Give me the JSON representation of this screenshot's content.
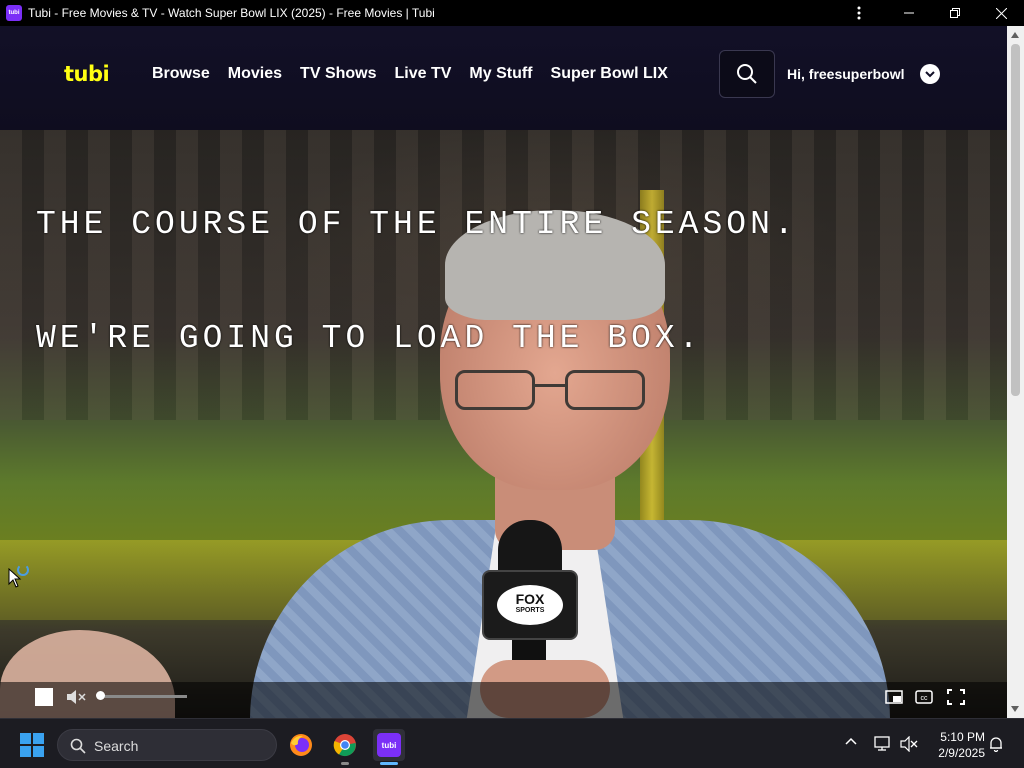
{
  "window": {
    "title": "Tubi - Free Movies & TV - Watch Super Bowl LIX (2025) - Free Movies | Tubi",
    "app_icon_text": "tubi"
  },
  "header": {
    "logo": "tubi",
    "nav": [
      "Browse",
      "Movies",
      "TV Shows",
      "Live TV",
      "My Stuff",
      "Super Bowl LIX"
    ],
    "greeting": "Hi, freesuperbowl",
    "brand_color": "#ffff13"
  },
  "video": {
    "captions": [
      "THE COURSE OF THE ENTIRE SEASON.",
      "WE'RE GOING TO LOAD THE BOX."
    ],
    "mic_logo_top": "FOX",
    "mic_logo_bottom": "SPORTS",
    "volume_level": 0.05,
    "muted": true
  },
  "taskbar": {
    "search_placeholder": "Search",
    "time": "5:10 PM",
    "date": "2/9/2025",
    "tubi_tile_text": "tubi"
  },
  "icons": [
    "kebab-icon",
    "minimize-icon",
    "maximize-icon",
    "close-icon",
    "search-icon",
    "chevron-down-icon",
    "stop-icon",
    "mute-icon",
    "pip-icon",
    "cc-icon",
    "fullscreen-icon",
    "windows-icon",
    "firefox-icon",
    "chrome-icon",
    "tubi-icon",
    "network-icon",
    "volume-off-icon",
    "bell-icon"
  ]
}
